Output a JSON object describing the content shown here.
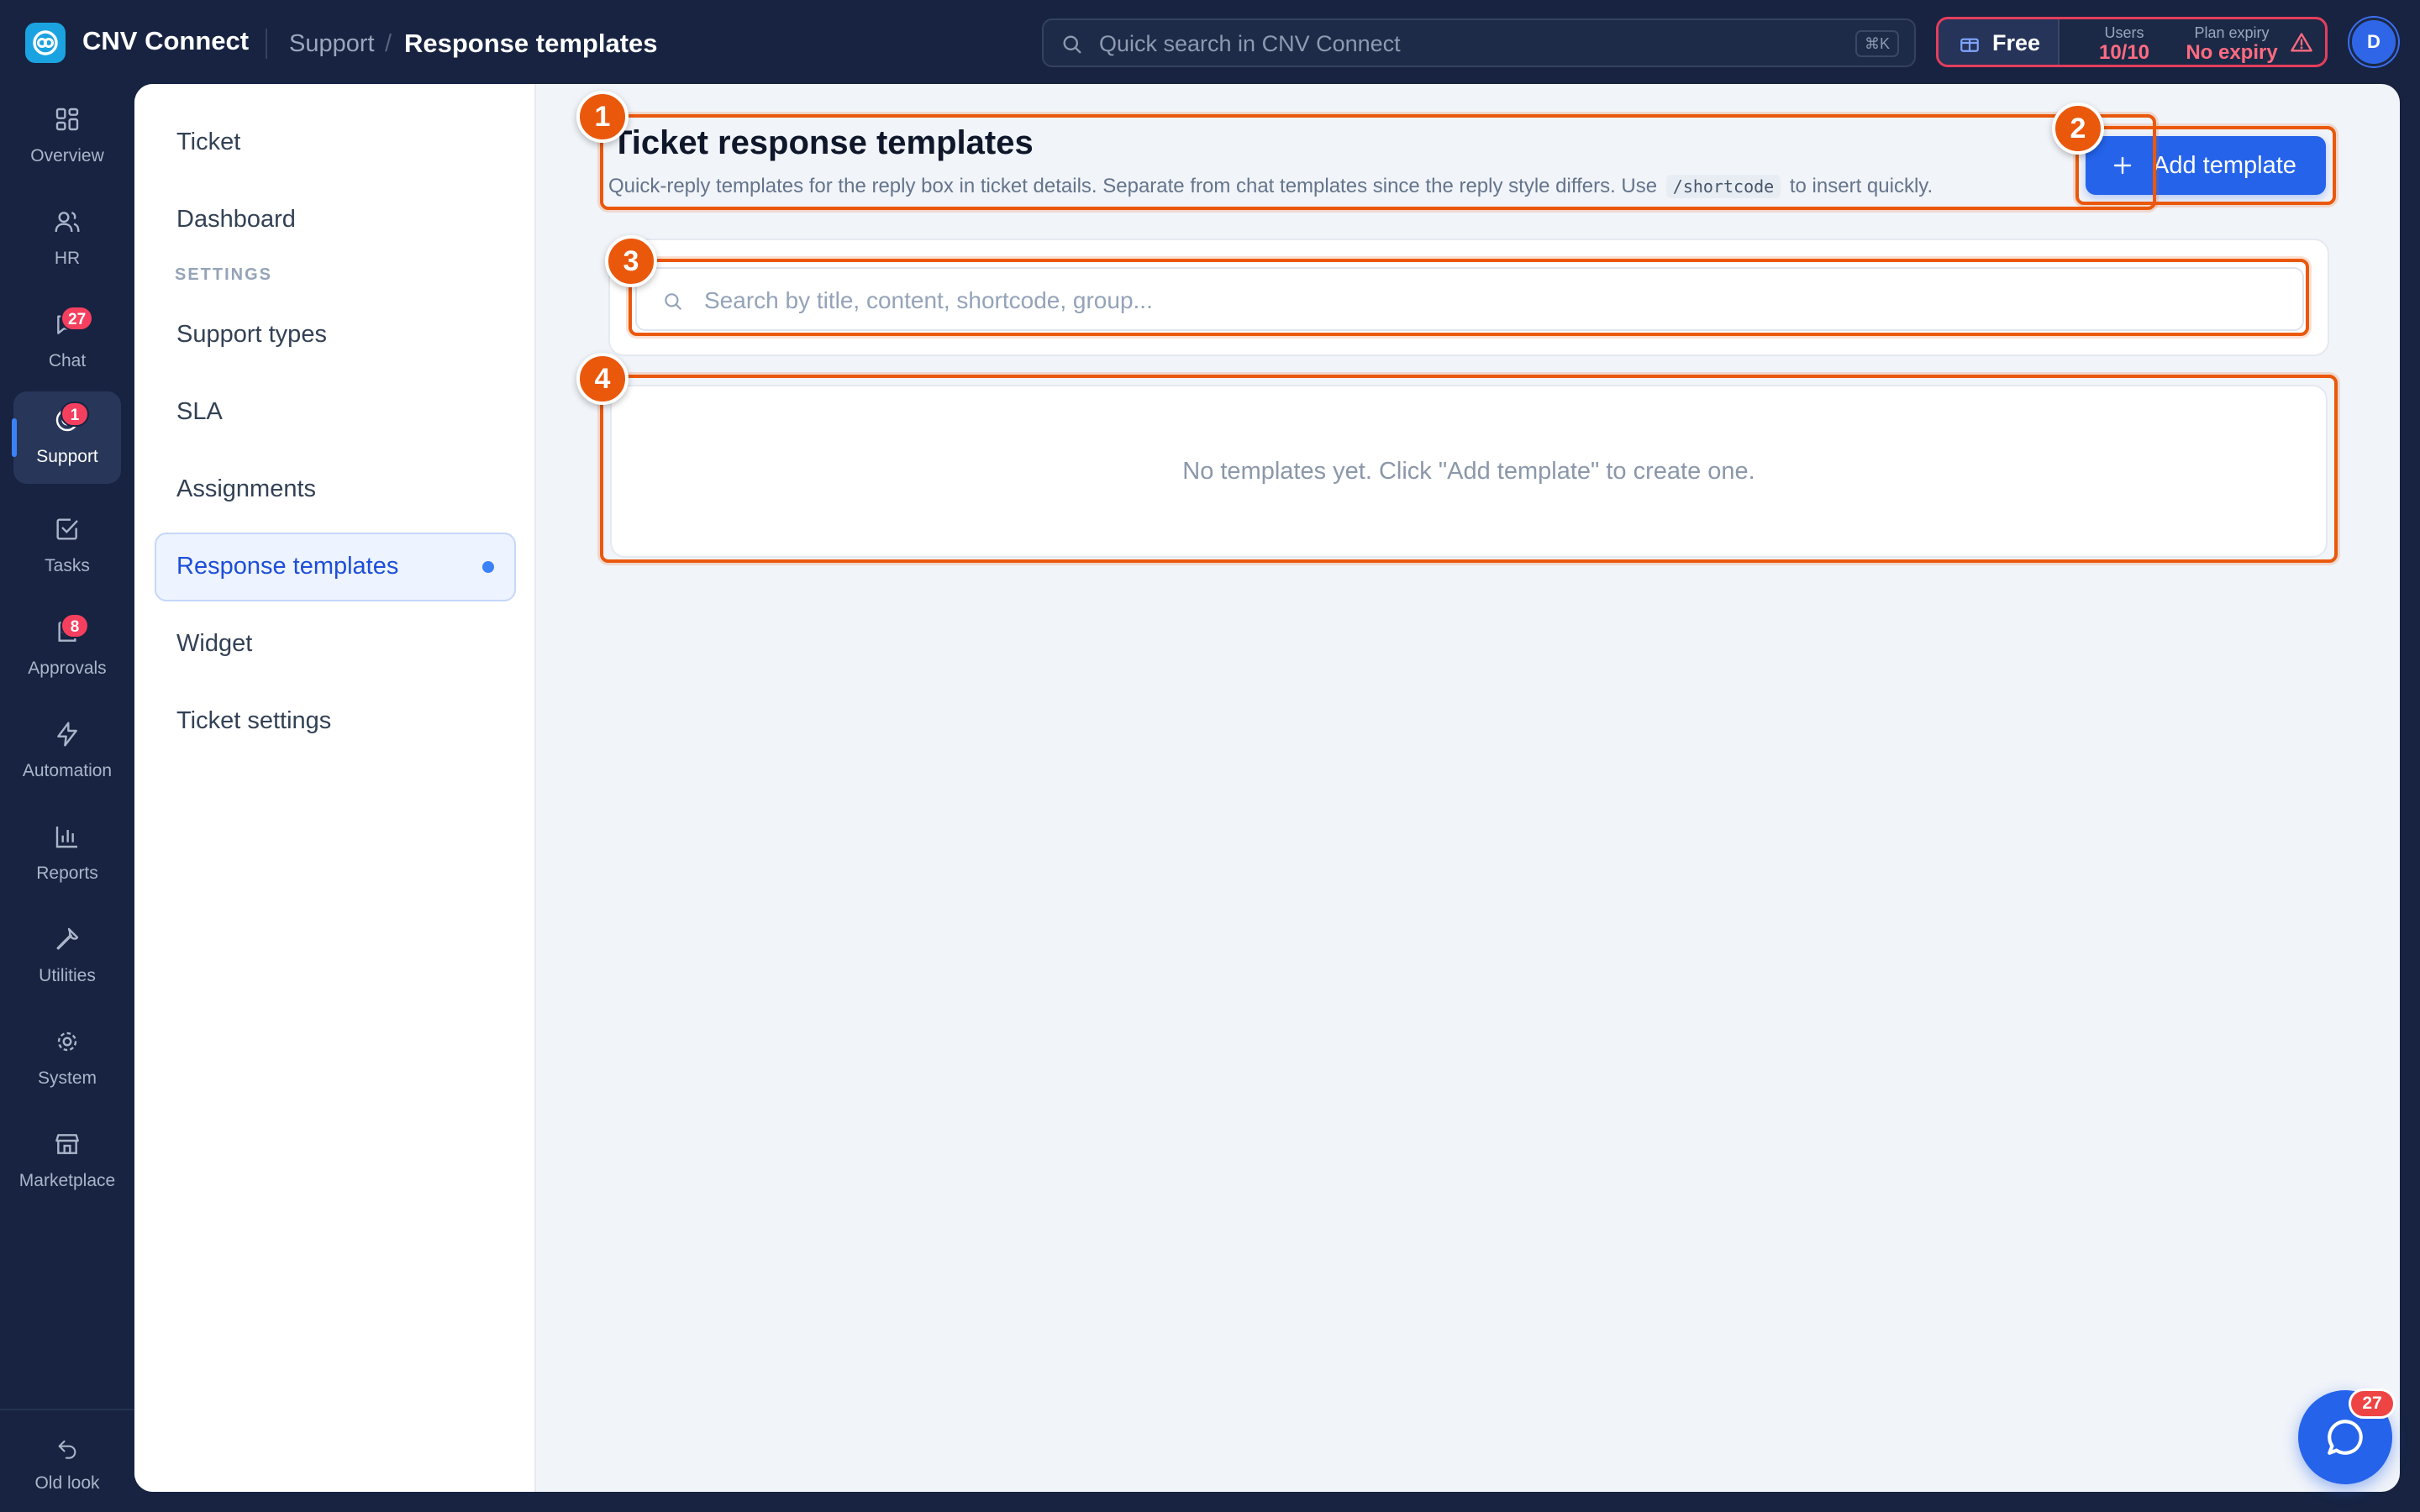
{
  "app": {
    "title": "CNV Connect"
  },
  "breadcrumb": {
    "section": "Support",
    "separator": "/",
    "page": "Response templates"
  },
  "search": {
    "placeholder": "Quick search in CNV Connect",
    "shortcut": "⌘K"
  },
  "plan": {
    "name": "Free",
    "users_label": "Users",
    "users_value": "10/10",
    "expiry_label": "Plan expiry",
    "expiry_value": "No expiry"
  },
  "user": {
    "initial": "D"
  },
  "rail": {
    "items": [
      {
        "label": "Overview",
        "icon": "grid-icon"
      },
      {
        "label": "HR",
        "icon": "users-icon"
      },
      {
        "label": "Chat",
        "icon": "chat-icon",
        "badge": "27"
      },
      {
        "label": "Support",
        "icon": "support-icon",
        "badge": "1",
        "active": true
      },
      {
        "label": "Tasks",
        "icon": "task-check-icon"
      },
      {
        "label": "Approvals",
        "icon": "approval-icon",
        "badge": "8"
      },
      {
        "label": "Automation",
        "icon": "lightning-icon"
      },
      {
        "label": "Reports",
        "icon": "bar-chart-icon"
      },
      {
        "label": "Utilities",
        "icon": "wrench-icon"
      },
      {
        "label": "System",
        "icon": "gear-icon"
      },
      {
        "label": "Marketplace",
        "icon": "store-icon"
      }
    ],
    "old_look": "Old look"
  },
  "subnav": {
    "items_top": [
      "Ticket",
      "Dashboard"
    ],
    "section_label": "SETTINGS",
    "items_settings": [
      "Support types",
      "SLA",
      "Assignments",
      "Response templates",
      "Widget",
      "Ticket settings"
    ],
    "active": "Response templates"
  },
  "content": {
    "title": "Ticket response templates",
    "description_before": "Quick-reply templates for the reply box in ticket details. Separate from chat templates since the reply style differs. Use",
    "description_code": "/shortcode",
    "description_after": "to insert quickly.",
    "add_button": "Add template",
    "filter_placeholder": "Search by title, content, shortcode, group...",
    "empty_message": "No templates yet. Click \"Add template\" to create one."
  },
  "annotations": [
    "1",
    "2",
    "3",
    "4"
  ],
  "chat_fab": {
    "badge": "27"
  },
  "colors": {
    "sidebar_bg": "#172341",
    "accent": "#2563eb",
    "annotation": "#ea580c",
    "danger": "#f43f5e"
  }
}
